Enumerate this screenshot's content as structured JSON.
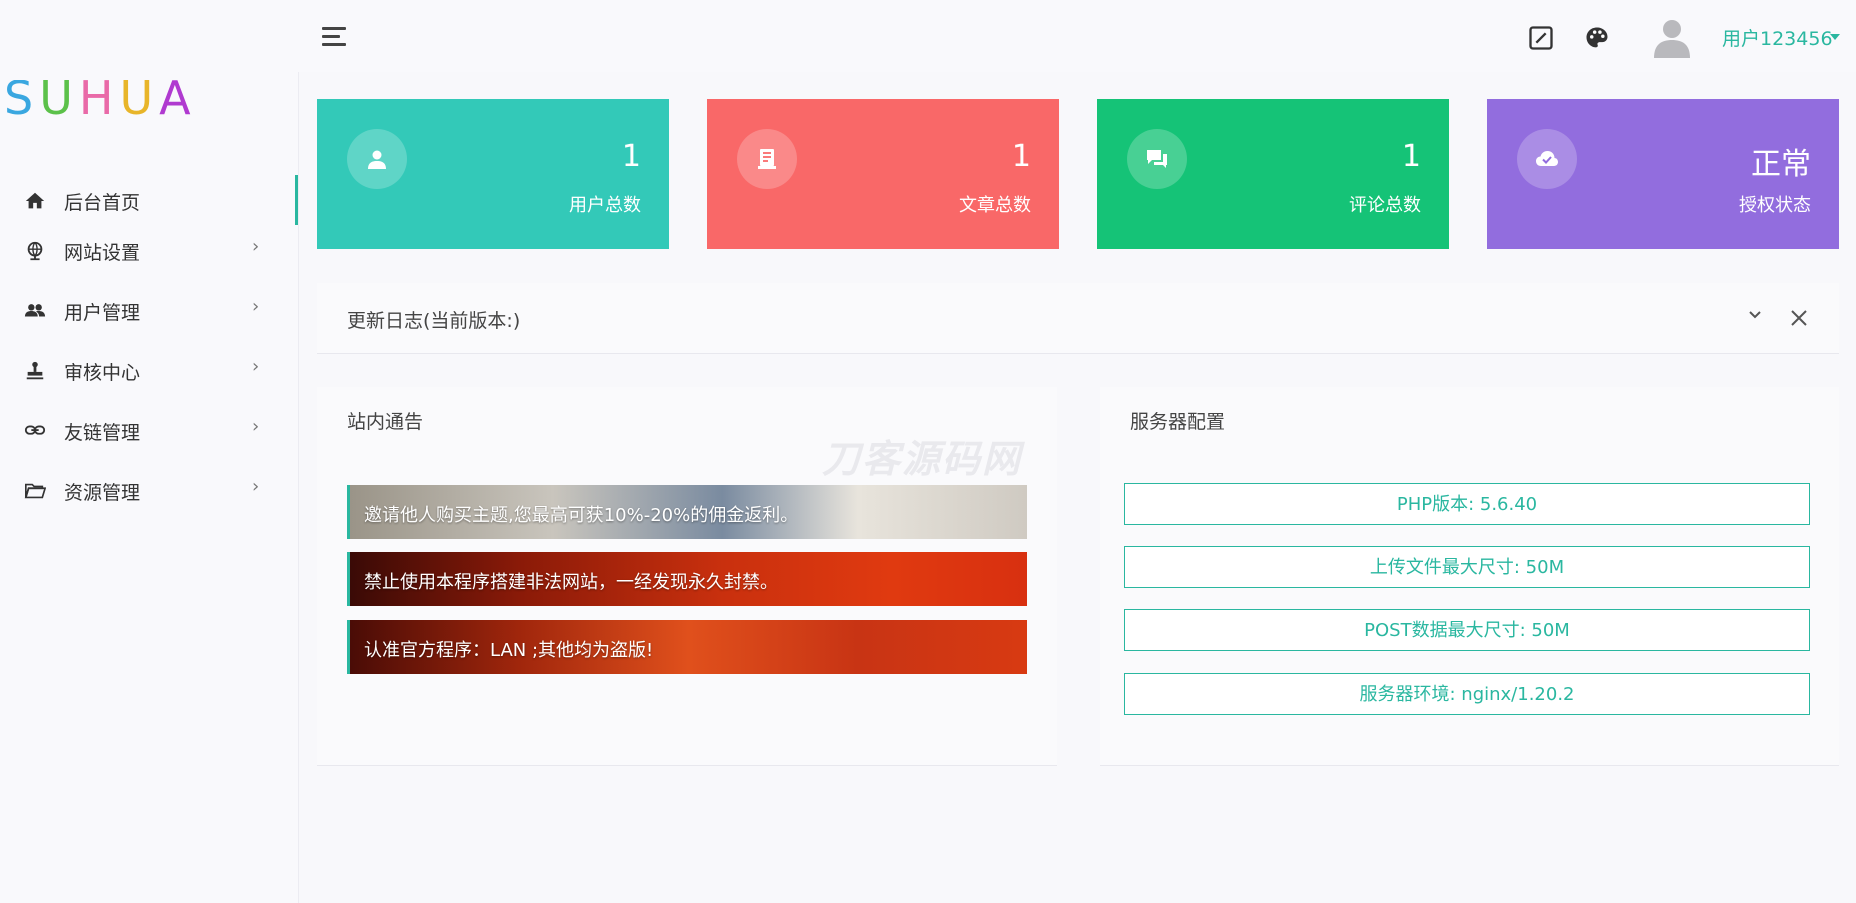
{
  "brand": {
    "logo_text": "SUHUA"
  },
  "header": {
    "user_name": "用户123456"
  },
  "sidebar": {
    "items": [
      {
        "label": "后台首页",
        "arrow": "",
        "icon": "home-icon"
      },
      {
        "label": "网站设置",
        "arrow": "›",
        "icon": "globe-icon"
      },
      {
        "label": "用户管理",
        "arrow": "›",
        "icon": "users-icon"
      },
      {
        "label": "审核中心",
        "arrow": "›",
        "icon": "stamp-icon"
      },
      {
        "label": "友链管理",
        "arrow": "›",
        "icon": "link-icon"
      },
      {
        "label": "资源管理",
        "arrow": "›",
        "icon": "folder-icon"
      }
    ]
  },
  "stats": [
    {
      "value": "1",
      "label": "用户总数",
      "color": "#33c9b8",
      "icon": "user-icon"
    },
    {
      "value": "1",
      "label": "文章总数",
      "color": "#f96868",
      "icon": "article-icon"
    },
    {
      "value": "1",
      "label": "评论总数",
      "color": "#15c377",
      "icon": "comment-icon"
    },
    {
      "value": "正常",
      "label": "授权状态",
      "color": "#926dde",
      "icon": "cloud-check-icon"
    }
  ],
  "changelog": {
    "title": "更新日志(当前版本:)"
  },
  "notices": {
    "title": "站内通告",
    "items": [
      "邀请他人购买主题,您最高可获10%-20%的佣金返利。",
      "禁止使用本程序搭建非法网站，一经发现永久封禁。",
      "认准官方程序：LAN ;其他均为盗版!"
    ]
  },
  "server": {
    "title": "服务器配置",
    "items": [
      "PHP版本: 5.6.40",
      "上传文件最大尺寸: 50M",
      "POST数据最大尺寸: 50M",
      "服务器环境: nginx/1.20.2"
    ]
  },
  "watermark": "刀客源码网",
  "colors": {
    "accent": "#2ab7a0"
  }
}
